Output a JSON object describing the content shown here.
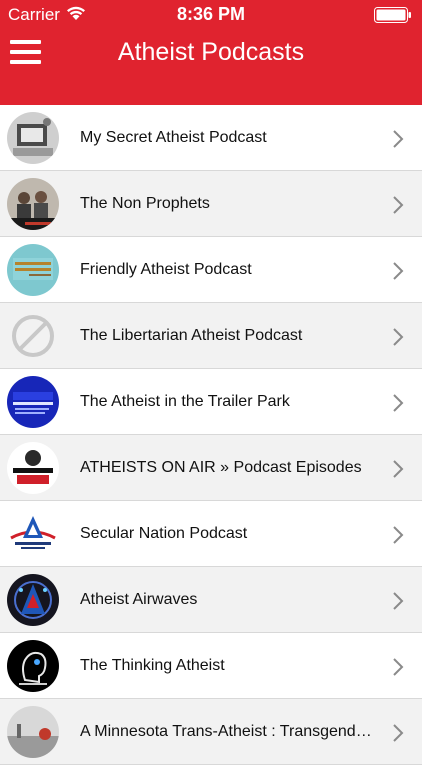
{
  "status_bar": {
    "carrier": "Carrier",
    "time": "8:36 PM"
  },
  "nav": {
    "title": "Atheist Podcasts",
    "menu_icon": "hamburger-menu-icon"
  },
  "colors": {
    "brand_red": "#e0232f"
  },
  "podcasts": [
    {
      "title": "My Secret Atheist Podcast"
    },
    {
      "title": "The Non Prophets"
    },
    {
      "title": "Friendly Atheist Podcast",
      "thumb_text": "FRIENDLY ATHEIST Podcast"
    },
    {
      "title": "The Libertarian Atheist Podcast",
      "thumb_text": "No Image available"
    },
    {
      "title": "The Atheist in the Trailer Park",
      "thumb_text": "Atheist IN THE TRAILER PARK"
    },
    {
      "title": "ATHEISTS ON AIR » Podcast Episodes",
      "thumb_text": "ATHEISTS ON AIR"
    },
    {
      "title": "Secular Nation Podcast",
      "thumb_text": "ATHEIST ALLIANCE of AMERICA"
    },
    {
      "title": "Atheist Airwaves"
    },
    {
      "title": "The Thinking Atheist"
    },
    {
      "title": "A Minnesota Trans-Atheist : Transgend…"
    }
  ]
}
